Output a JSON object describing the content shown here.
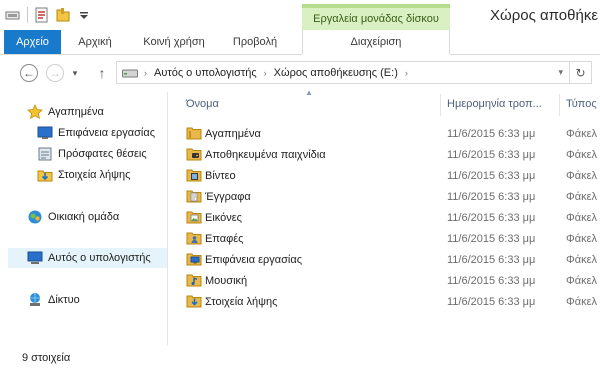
{
  "window": {
    "title": "Χώρος αποθήκε",
    "context_group": "Εργαλεία μονάδας δίσκου"
  },
  "quick_access": [
    {
      "icon": "properties-icon"
    },
    {
      "icon": "new-folder-icon"
    },
    {
      "icon": "customize-dropdown-icon"
    }
  ],
  "ribbon": {
    "tabs": [
      "Αρχείο",
      "Αρχική",
      "Κοινή χρήση",
      "Προβολή",
      "Διαχείριση"
    ]
  },
  "address": {
    "crumbs": [
      "Αυτός ο υπολογιστής",
      "Χώρος αποθήκευσης (E:)"
    ]
  },
  "navigation": {
    "favorites": "Αγαπημένα",
    "favorites_items": [
      "Επιφάνεια εργασίας",
      "Πρόσφατες θέσεις",
      "Στοιχεία λήψης"
    ],
    "homegroup": "Οικιακή ομάδα",
    "this_pc": "Αυτός ο υπολογιστής",
    "network": "Δίκτυο"
  },
  "columns": {
    "name": "Όνομα",
    "date": "Ημερομηνία τροπ...",
    "type": "Τύπος"
  },
  "files": [
    {
      "name": "Αγαπημένα",
      "date": "11/6/2015 6:33 μμ",
      "type": "Φάκελ",
      "icon": "favorites-folder-icon"
    },
    {
      "name": "Αποθηκευμένα παιχνίδια",
      "date": "11/6/2015 6:33 μμ",
      "type": "Φάκελ",
      "icon": "saved-games-folder-icon"
    },
    {
      "name": "Βίντεο",
      "date": "11/6/2015 6:33 μμ",
      "type": "Φάκελ",
      "icon": "videos-folder-icon"
    },
    {
      "name": "Έγγραφα",
      "date": "11/6/2015 6:33 μμ",
      "type": "Φάκελ",
      "icon": "documents-folder-icon"
    },
    {
      "name": "Εικόνες",
      "date": "11/6/2015 6:33 μμ",
      "type": "Φάκελ",
      "icon": "pictures-folder-icon"
    },
    {
      "name": "Επαφές",
      "date": "11/6/2015 6:33 μμ",
      "type": "Φάκελ",
      "icon": "contacts-folder-icon"
    },
    {
      "name": "Επιφάνεια εργασίας",
      "date": "11/6/2015 6:33 μμ",
      "type": "Φάκελ",
      "icon": "desktop-folder-icon"
    },
    {
      "name": "Μουσική",
      "date": "11/6/2015 6:33 μμ",
      "type": "Φάκελ",
      "icon": "music-folder-icon"
    },
    {
      "name": "Στοιχεία λήψης",
      "date": "11/6/2015 6:33 μμ",
      "type": "Φάκελ",
      "icon": "downloads-folder-icon"
    }
  ],
  "status": {
    "item_count": "9 στοιχεία"
  },
  "colors": {
    "file_tab": "#1979ca",
    "context_tab": "#d9f0c3",
    "selection": "#e5f3fb",
    "folder": "#e8b84b"
  }
}
